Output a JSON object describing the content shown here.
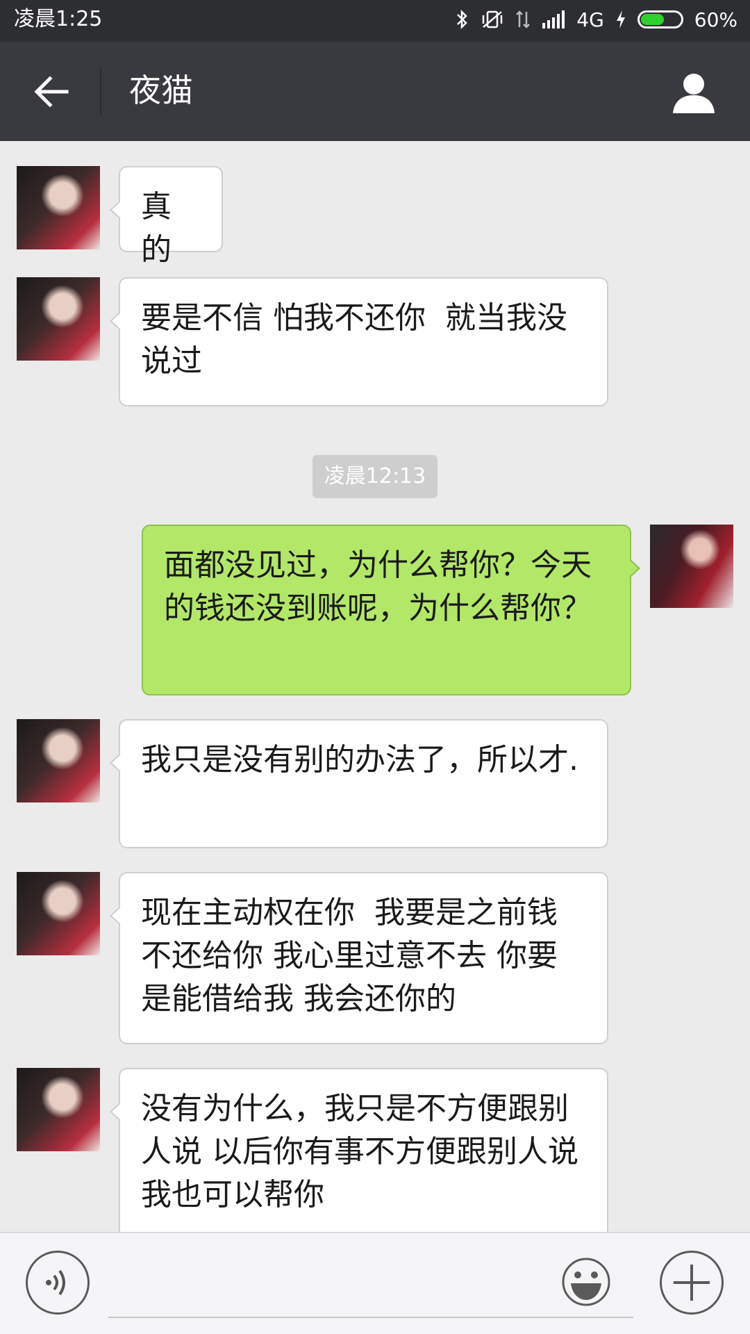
{
  "status_bar": {
    "time": "凌晨1:25",
    "network": "4G",
    "battery": "60%",
    "battery_level": 0.6
  },
  "header": {
    "title": "夜猫",
    "back_icon": "arrow-left-icon",
    "profile_icon": "person-icon"
  },
  "messages": [
    {
      "side": "left",
      "text": "真的"
    },
    {
      "side": "left",
      "text": "要是不信 怕我不还你  就当我没说过"
    },
    {
      "side": "time",
      "text": "凌晨12:13"
    },
    {
      "side": "right",
      "text": "面都没见过，为什么帮你？今天的钱还没到账呢，为什么帮你？"
    },
    {
      "side": "left",
      "text": "我只是没有别的办法了，所以才."
    },
    {
      "side": "left",
      "text": "现在主动权在你  我要是之前钱不还给你 我心里过意不去 你要是能借给我 我会还你的"
    },
    {
      "side": "left",
      "text": "没有为什么，我只是不方便跟别人说 以后你有事不方便跟别人说 我也可以帮你"
    }
  ],
  "input_bar": {
    "voice_icon": "voice-icon",
    "emoji_icon": "emoji-icon",
    "plus_icon": "plus-icon"
  },
  "colors": {
    "header_bg": "#393a3f",
    "statusbar_bg": "#2d2e31",
    "chat_bg": "#ebebeb",
    "sent_bubble": "#b2e768",
    "received_bubble": "#ffffff"
  }
}
